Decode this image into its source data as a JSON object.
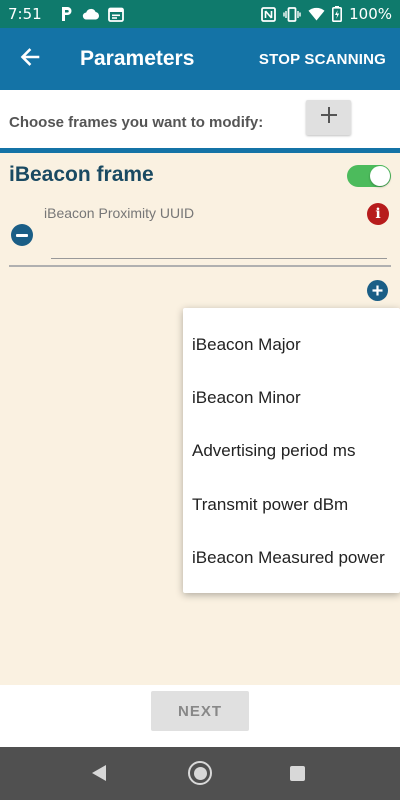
{
  "status_bar": {
    "time": "7:51",
    "battery_text": "100%",
    "left_icons": [
      "parking-icon",
      "cloud-icon",
      "calendar-icon"
    ],
    "right_icons": [
      "nfc-icon",
      "vibrate-icon",
      "wifi-icon",
      "battery-icon"
    ]
  },
  "app_bar": {
    "title": "Parameters",
    "action_label": "STOP SCANNING",
    "back_icon": "arrow-back-icon"
  },
  "frames_selector": {
    "label": "Choose frames you want to modify:",
    "add_button_icon": "plus-icon"
  },
  "frame": {
    "title": "iBeacon frame",
    "enabled": true,
    "fields": [
      {
        "label": "iBeacon Proximity UUID",
        "value": "",
        "info_icon": "info-icon",
        "remove_icon": "minus-circle-icon"
      }
    ],
    "add_field_icon": "plus-circle-icon"
  },
  "dropdown": {
    "items": [
      "iBeacon Major",
      "iBeacon Minor",
      "Advertising period ms",
      "Transmit power dBm",
      "iBeacon Measured power"
    ]
  },
  "footer": {
    "next_label": "NEXT"
  },
  "colors": {
    "status_bar": "#0f7a6c",
    "app_bar": "#1473a6",
    "content_bg": "#faf1e1",
    "toggle_on": "#4cbb5c",
    "info": "#b71c1c",
    "nav_bar": "#505050"
  }
}
